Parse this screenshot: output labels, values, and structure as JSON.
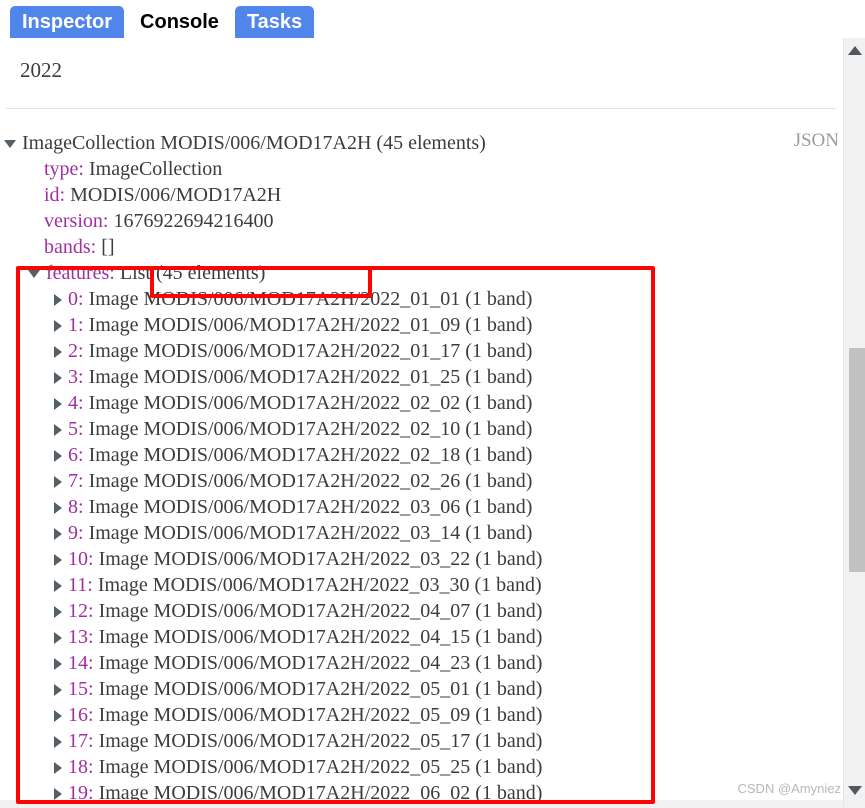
{
  "tabs": [
    {
      "label": "Inspector",
      "active": false
    },
    {
      "label": "Console",
      "active": true
    },
    {
      "label": "Tasks",
      "active": false
    }
  ],
  "console": {
    "year_output": "2022",
    "json_link": "JSON",
    "header": "ImageCollection MODIS/006/MOD17A2H (45 elements)",
    "properties": [
      {
        "key": "type:",
        "value": "ImageCollection"
      },
      {
        "key": "id:",
        "value": "MODIS/006/MOD17A2H"
      },
      {
        "key": "version:",
        "value": "1676922694216400"
      },
      {
        "key": "bands:",
        "value": "[]"
      }
    ],
    "features_key": "features:",
    "features_value": "List (45 elements)",
    "features": [
      {
        "index": "0:",
        "text": "Image MODIS/006/MOD17A2H/2022_01_01 (1 band)"
      },
      {
        "index": "1:",
        "text": "Image MODIS/006/MOD17A2H/2022_01_09 (1 band)"
      },
      {
        "index": "2:",
        "text": "Image MODIS/006/MOD17A2H/2022_01_17 (1 band)"
      },
      {
        "index": "3:",
        "text": "Image MODIS/006/MOD17A2H/2022_01_25 (1 band)"
      },
      {
        "index": "4:",
        "text": "Image MODIS/006/MOD17A2H/2022_02_02 (1 band)"
      },
      {
        "index": "5:",
        "text": "Image MODIS/006/MOD17A2H/2022_02_10 (1 band)"
      },
      {
        "index": "6:",
        "text": "Image MODIS/006/MOD17A2H/2022_02_18 (1 band)"
      },
      {
        "index": "7:",
        "text": "Image MODIS/006/MOD17A2H/2022_02_26 (1 band)"
      },
      {
        "index": "8:",
        "text": "Image MODIS/006/MOD17A2H/2022_03_06 (1 band)"
      },
      {
        "index": "9:",
        "text": "Image MODIS/006/MOD17A2H/2022_03_14 (1 band)"
      },
      {
        "index": "10:",
        "text": "Image MODIS/006/MOD17A2H/2022_03_22 (1 band)"
      },
      {
        "index": "11:",
        "text": "Image MODIS/006/MOD17A2H/2022_03_30 (1 band)"
      },
      {
        "index": "12:",
        "text": "Image MODIS/006/MOD17A2H/2022_04_07 (1 band)"
      },
      {
        "index": "13:",
        "text": "Image MODIS/006/MOD17A2H/2022_04_15 (1 band)"
      },
      {
        "index": "14:",
        "text": "Image MODIS/006/MOD17A2H/2022_04_23 (1 band)"
      },
      {
        "index": "15:",
        "text": "Image MODIS/006/MOD17A2H/2022_05_01 (1 band)"
      },
      {
        "index": "16:",
        "text": "Image MODIS/006/MOD17A2H/2022_05_09 (1 band)"
      },
      {
        "index": "17:",
        "text": "Image MODIS/006/MOD17A2H/2022_05_17 (1 band)"
      },
      {
        "index": "18:",
        "text": "Image MODIS/006/MOD17A2H/2022_05_25 (1 band)"
      },
      {
        "index": "19:",
        "text": "Image MODIS/006/MOD17A2H/2022_06_02 (1 band)"
      }
    ]
  },
  "watermark": "CSDN @Amyniez",
  "colors": {
    "tab_active_bg": "#ffffff",
    "tab_inactive_bg": "#5086ec",
    "key_purple": "#a32ea3",
    "annotation_red": "#fb0404",
    "text": "#3c3c3c"
  }
}
